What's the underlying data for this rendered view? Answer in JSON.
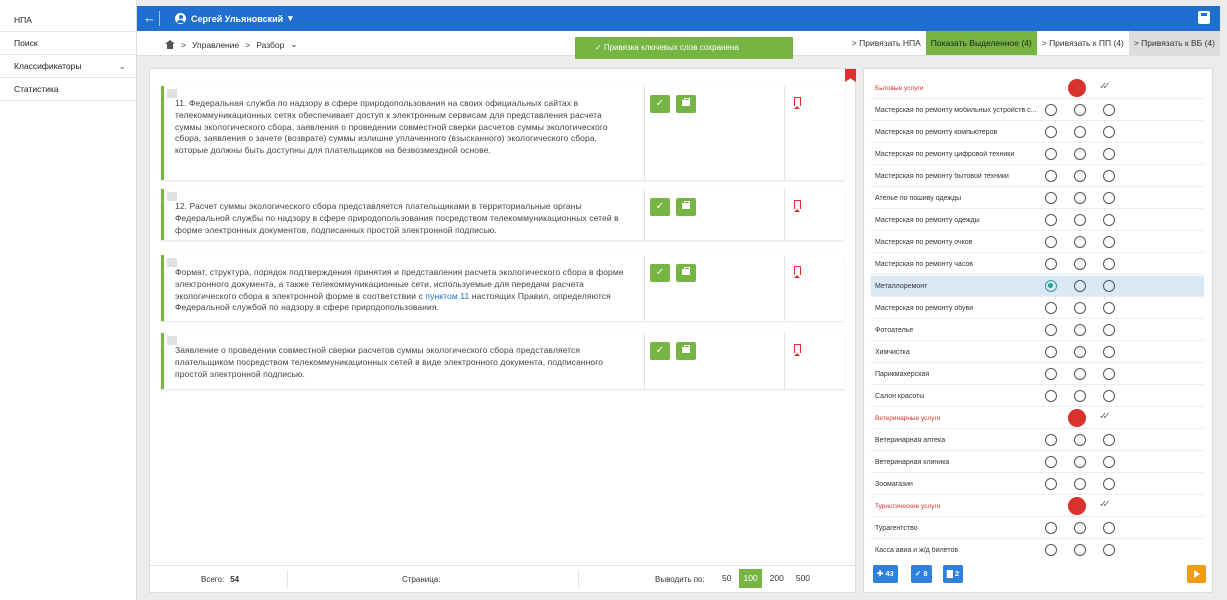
{
  "sidebar": {
    "items": [
      {
        "label": "НПА"
      },
      {
        "label": "Поиск"
      },
      {
        "label": "Классификаторы"
      },
      {
        "label": "Статистика"
      }
    ]
  },
  "topbar": {
    "back_icon": "arrow-left-icon",
    "user_name": "Сергей Ульяновский",
    "user_caret": "▾"
  },
  "breadcrumb": {
    "items": [
      "Управление",
      "Разбор"
    ],
    "sep": ">",
    "dropdown": "⌄"
  },
  "toast": "✓ Привязка ключевых слов сохранена",
  "tabs": [
    {
      "label": "> Привязать НПА"
    },
    {
      "label": "Показать Выделенное (4)"
    },
    {
      "label": "> Привязать к ПП (4)"
    },
    {
      "label": "> Привязать к ВБ (4)"
    }
  ],
  "cards": [
    {
      "text": "11. Федеральная служба по надзору в сфере природопользования на своих официальных сайтах в телекоммуникационных сетях обеспечивает доступ к электронным сервисам для представления расчета суммы экологического сбора, заявления о проведении совместной сверки расчетов суммы экологического сбора, заявления о зачете (возврате) суммы излишне уплаченного (взысканного) экологического сбора, которые должны быть доступны для плательщиков на безвозмездной основе."
    },
    {
      "text": "12. Расчет суммы экологического сбора представляется плательщиками в территориальные органы Федеральной службы по надзору в сфере природопользования посредством телекоммуникационных сетей в форме электронных документов, подписанных простой электронной подписью."
    },
    {
      "text_before": "Формат, структура, порядок подтверждения принятия и представления расчета экологического сбора в форме электронного документа, а также телекоммуникационные сети, используемые для передачи расчета экологического сбора в электронной форме в соответствии с ",
      "link": "пунктом 11",
      "text_after": " настоящих Правил, определяются Федеральной службой по надзору в сфере природопользования."
    },
    {
      "text": "Заявление о проведении совместной сверки расчетов суммы экологического сбора представляется плательщиком посредством телекоммуникационных сетей в виде электронного документа, подписанного простой электронной подписью."
    }
  ],
  "card_buttons": {
    "check": "✓"
  },
  "footer": {
    "total_label": "Всего:",
    "total_value": "54",
    "page_label": "Страница:",
    "per_page_label": "Выводить по:",
    "per_page_options": [
      "50",
      "100",
      "200",
      "500"
    ],
    "per_page_selected": "100"
  },
  "right_panel": {
    "rows": [
      {
        "type": "category",
        "label": "Бытовые услуги"
      },
      {
        "type": "item",
        "label": "Мастерская по ремонту мобильных устройств с..."
      },
      {
        "type": "item",
        "label": "Мастерская по ремонту компьютеров"
      },
      {
        "type": "item",
        "label": "Мастерская по ремонту цифровой техники"
      },
      {
        "type": "item",
        "label": "Мастерская по ремонту бытовой техники"
      },
      {
        "type": "item",
        "label": "Ателье по пошиву одежды"
      },
      {
        "type": "item",
        "label": "Мастерская по ремонту одежды"
      },
      {
        "type": "item",
        "label": "Мастерская по ремонту очков"
      },
      {
        "type": "item",
        "label": "Мастерская по ремонту часов"
      },
      {
        "type": "item",
        "label": "Металлоремонт",
        "selected": true
      },
      {
        "type": "item",
        "label": "Мастерская по ремонту обуви"
      },
      {
        "type": "item",
        "label": "Фотоателье"
      },
      {
        "type": "item",
        "label": "Химчистка"
      },
      {
        "type": "item",
        "label": "Парикмахерская"
      },
      {
        "type": "item",
        "label": "Салон красоты"
      },
      {
        "type": "category",
        "label": "Ветеринарные услуги"
      },
      {
        "type": "item",
        "label": "Ветеринарная аптека"
      },
      {
        "type": "item",
        "label": "Ветеринарная клиника"
      },
      {
        "type": "item",
        "label": "Зоомагазин"
      },
      {
        "type": "category",
        "label": "Туристические услуги"
      },
      {
        "type": "item",
        "label": "Турагентство"
      },
      {
        "type": "item",
        "label": "Касса авиа и ж/д билетов"
      }
    ],
    "double_check": "✓✓",
    "footer_buttons": [
      {
        "icon": "puzzle-icon",
        "label": "✚ 43"
      },
      {
        "icon": "check-icon",
        "label": "✓ 8"
      },
      {
        "icon": "briefcase-icon",
        "label": "▇ 2"
      }
    ]
  },
  "colors": {
    "accent_blue": "#1f6fd0",
    "accent_green": "#76b543",
    "red": "#d9322d",
    "orange": "#f39c12"
  }
}
